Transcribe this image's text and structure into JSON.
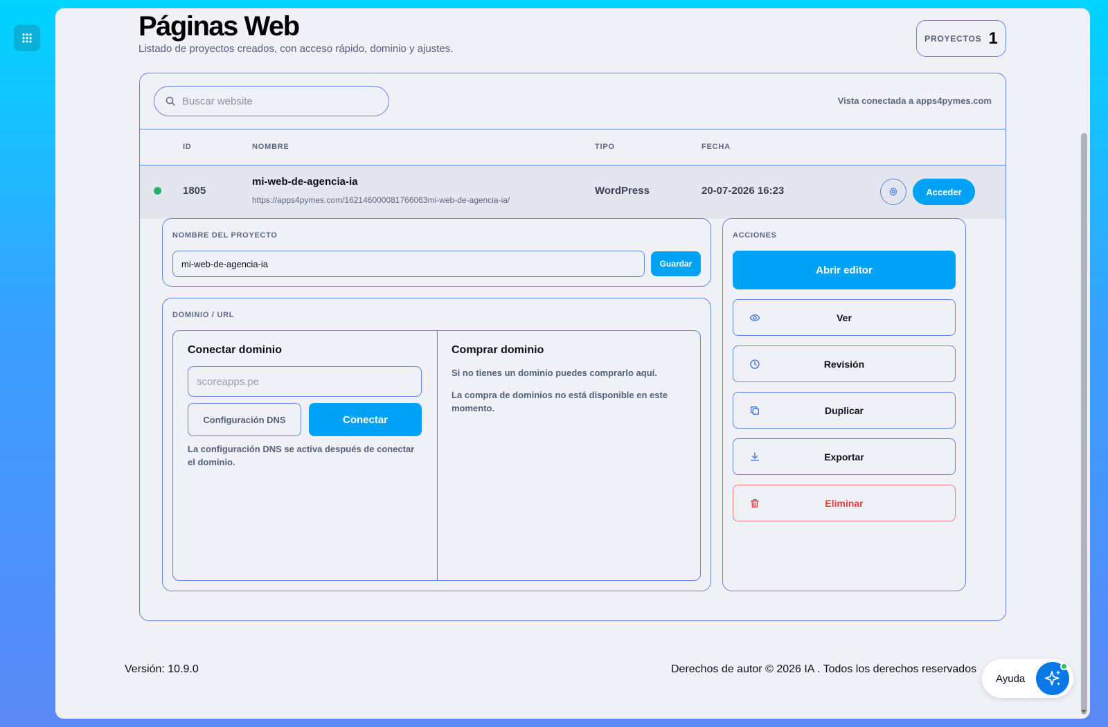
{
  "header": {
    "title": "Páginas Web",
    "subtitle": "Listado de proyectos creados, con acceso rápido, dominio y ajustes.",
    "counter_label": "PROYECTOS",
    "counter_value": "1"
  },
  "toolbar": {
    "search_placeholder": "Buscar website",
    "connected_text": "Vista conectada a apps4pymes.com"
  },
  "table": {
    "columns": [
      "ID",
      "NOMBRE",
      "TIPO",
      "FECHA"
    ],
    "rows": [
      {
        "status": "active",
        "id": "1805",
        "name": "mi-web-de-agencia-ia",
        "url": "https://apps4pymes.com/162146000081766063mi-web-de-agencia-ia/",
        "type": "WordPress",
        "date": "20-07-2026 16:23",
        "access_label": "Acceder"
      }
    ]
  },
  "project_name": {
    "label": "NOMBRE DEL PROYECTO",
    "value": "mi-web-de-agencia-ia",
    "save_label": "Guardar"
  },
  "domain": {
    "label": "DOMINIO / URL",
    "connect_title": "Conectar dominio",
    "domain_placeholder": "scoreapps.pe",
    "dns_label": "Configuración DNS",
    "connect_label": "Conectar",
    "dns_note": "La configuración DNS se activa después de conectar el dominio.",
    "buy_title": "Comprar dominio",
    "buy_text": "Si no tienes un dominio puedes comprarlo aquí.",
    "buy_unavailable": "La compra de dominios no está disponible en este momento."
  },
  "actions": {
    "label": "ACCIONES",
    "open_editor": "Abrir editor",
    "items": [
      {
        "label": "Ver",
        "icon": "eye-icon"
      },
      {
        "label": "Revisión",
        "icon": "clock-icon"
      },
      {
        "label": "Duplicar",
        "icon": "copy-icon"
      },
      {
        "label": "Exportar",
        "icon": "download-icon"
      },
      {
        "label": "Eliminar",
        "icon": "trash-icon"
      }
    ]
  },
  "footer": {
    "version": "Versión: 10.9.0",
    "copyright": "Derechos de autor © 2026 IA . Todos los derechos reservados"
  },
  "help": {
    "label": "Ayuda"
  },
  "colors": {
    "accent": "#00a2f5",
    "border": "#5b82e8",
    "danger": "#e23b3b",
    "status_active": "#22b566"
  }
}
